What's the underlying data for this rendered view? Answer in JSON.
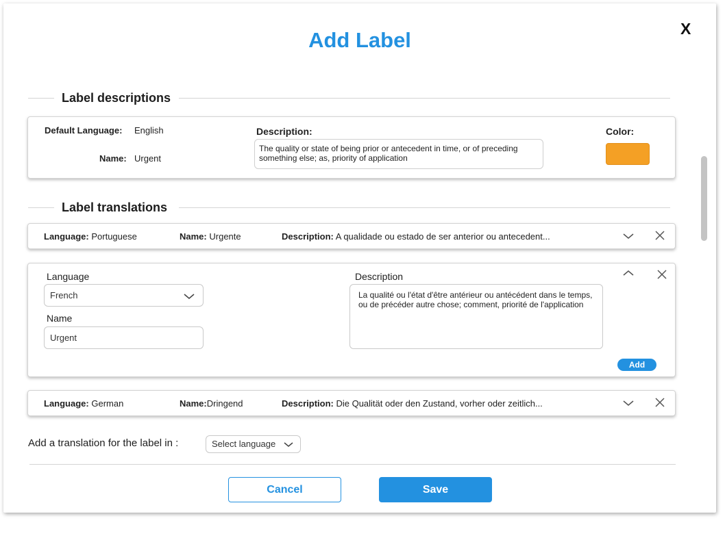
{
  "dialog": {
    "title": "Add Label",
    "close_label": "X"
  },
  "descriptions_section": {
    "title": "Label descriptions",
    "default_language_label": "Default Language:",
    "default_language_value": "English",
    "name_label": "Name:",
    "name_value": "Urgent",
    "description_label": "Description:",
    "description_value": "The quality or state of being prior or antecedent in time, or of preceding something else; as, priority of application",
    "color_label": "Color:",
    "color_value": "#f4a025"
  },
  "translations_section": {
    "title": "Label translations",
    "rows": [
      {
        "language_label": "Language:",
        "language": "Portuguese",
        "name_label": "Name:",
        "name": "Urgente",
        "description_label": "Description:",
        "description": "A qualidade ou estado de ser anterior ou antecedent..."
      },
      {
        "language_label": "Language:",
        "language": "German",
        "name_label": "Name:",
        "name": "Dringend",
        "description_label": "Description:",
        "description": "Die Qualität oder den Zustand, vorher oder zeitlich..."
      }
    ],
    "expanded": {
      "language_label": "Language",
      "language_value": "French",
      "name_label": "Name",
      "name_value": "Urgent",
      "description_label": "Description",
      "description_value": "La qualité ou l'état d'être antérieur ou antécédent dans le temps, ou de précéder autre chose; comment, priorité de l'application",
      "add_label": "Add"
    }
  },
  "add_translation": {
    "prompt": "Add a translation for the label in :",
    "select_placeholder": "Select language"
  },
  "footer": {
    "cancel_label": "Cancel",
    "save_label": "Save"
  },
  "icons": {
    "close": "close-icon",
    "chevron_down": "chevron-down-icon",
    "chevron_up": "chevron-up-icon"
  },
  "colors": {
    "accent": "#2391e0",
    "label_color": "#f4a025"
  }
}
